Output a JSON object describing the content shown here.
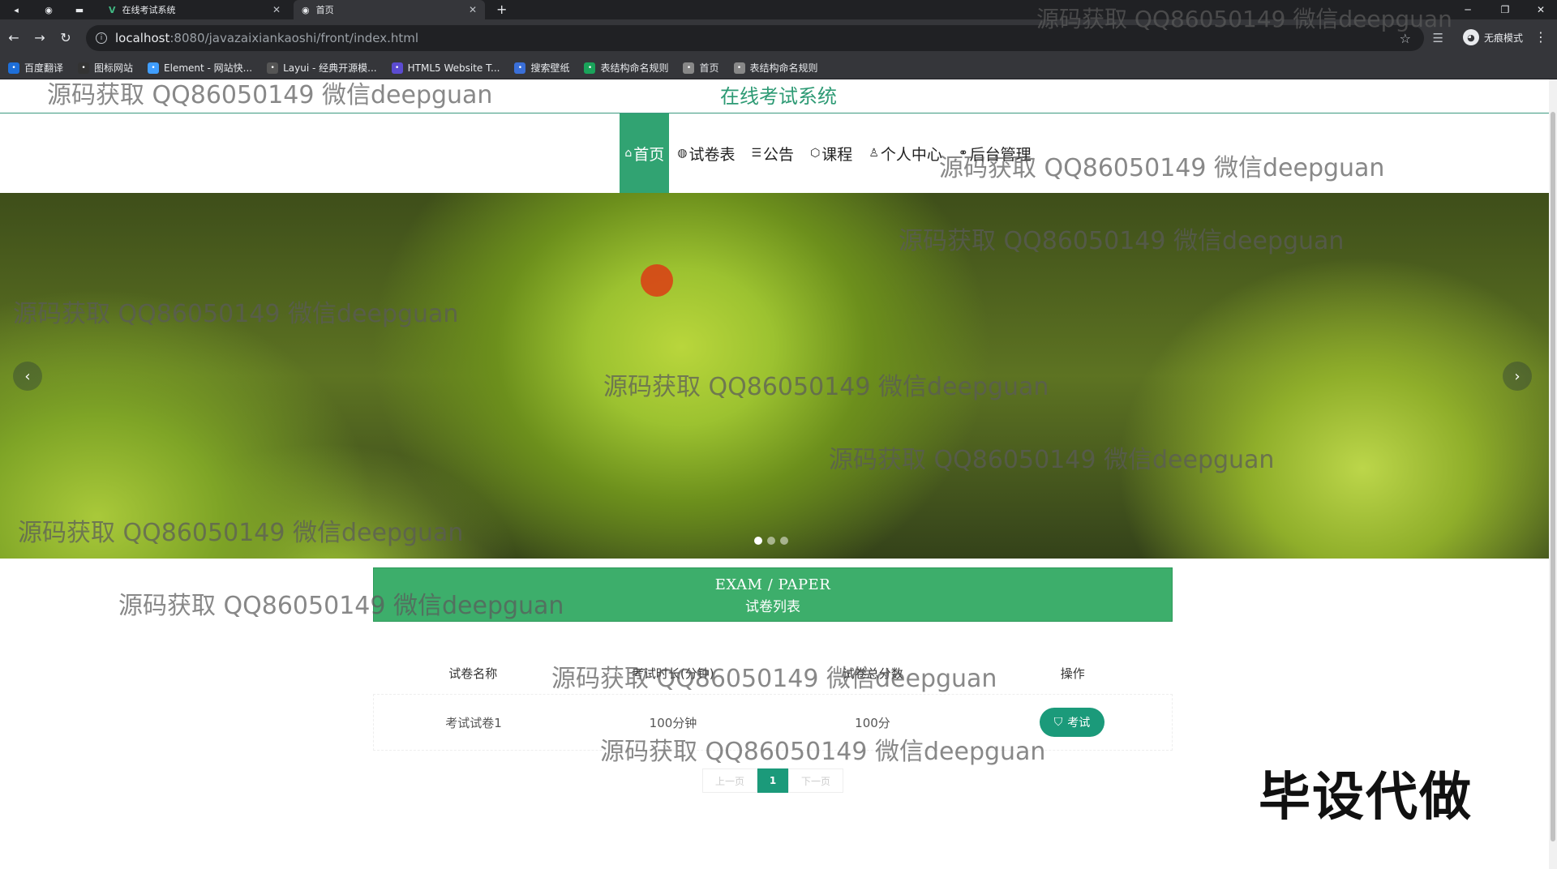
{
  "browser": {
    "tabs": [
      {
        "title": "在线考试系统"
      },
      {
        "title": "首页"
      }
    ],
    "url_host": "localhost",
    "url_path": ":8080/javazaixiankaoshi/front/index.html",
    "profile_label": "无痕模式",
    "bookmarks": [
      {
        "label": "百度翻译",
        "color": "#1e6fd9"
      },
      {
        "label": "图标网站",
        "color": "#333333"
      },
      {
        "label": "Element - 网站快...",
        "color": "#409eff"
      },
      {
        "label": "Layui - 经典开源模...",
        "color": "#555555"
      },
      {
        "label": "HTML5 Website T...",
        "color": "#5b4bd1"
      },
      {
        "label": "搜索壁纸",
        "color": "#3a6fd8"
      },
      {
        "label": "表结构命名规则",
        "color": "#1aa35a"
      },
      {
        "label": "首页",
        "color": "#888888"
      },
      {
        "label": "表结构命名规则",
        "color": "#888888"
      }
    ]
  },
  "site": {
    "title": "在线考试系统",
    "nav": [
      {
        "label": "首页",
        "icon": "home-icon",
        "active": true
      },
      {
        "label": "试卷表",
        "icon": "globe-icon"
      },
      {
        "label": "公告",
        "icon": "layers-icon"
      },
      {
        "label": "课程",
        "icon": "box-icon"
      },
      {
        "label": "个人中心",
        "icon": "user-icon"
      },
      {
        "label": "后台管理",
        "icon": "link-icon"
      }
    ]
  },
  "carousel": {
    "slide_count": 3,
    "active_slide": 1
  },
  "exam_section": {
    "title_en": "EXAM / PAPER",
    "title_cn": "试卷列表",
    "columns": [
      "试卷名称",
      "考试时长(分钟)",
      "试卷总分数",
      "操作"
    ],
    "rows": [
      {
        "name": "考试试卷1",
        "duration": "100分钟",
        "score": "100分",
        "action": "考试"
      }
    ]
  },
  "pagination": {
    "prev": "上一页",
    "current": "1",
    "next": "下一页"
  },
  "watermarks": [
    "源码获取 QQ86050149 微信deepguan",
    "源码获取 QQ86050149 微信deepguan",
    "源码获取 QQ86050149 微信deepguan",
    "源码获取 QQ86050149 微信deepguan",
    "源码获取 QQ86050149 微信deepguan",
    "源码获取 QQ86050149 微信deepguan",
    "源码获取 QQ86050149 微信deepguan",
    "源码获取 QQ86050149 微信deepguan",
    "源码获取 QQ86050149 微信deepguan",
    "源码获取 QQ86050149 微信deepguan",
    "源码获取 QQ86050149 微信deepguan"
  ],
  "stamp_text": "毕设代做",
  "colors": {
    "brand": "#31a372",
    "accent": "#1b9a7a",
    "title": "#2d9a74"
  }
}
